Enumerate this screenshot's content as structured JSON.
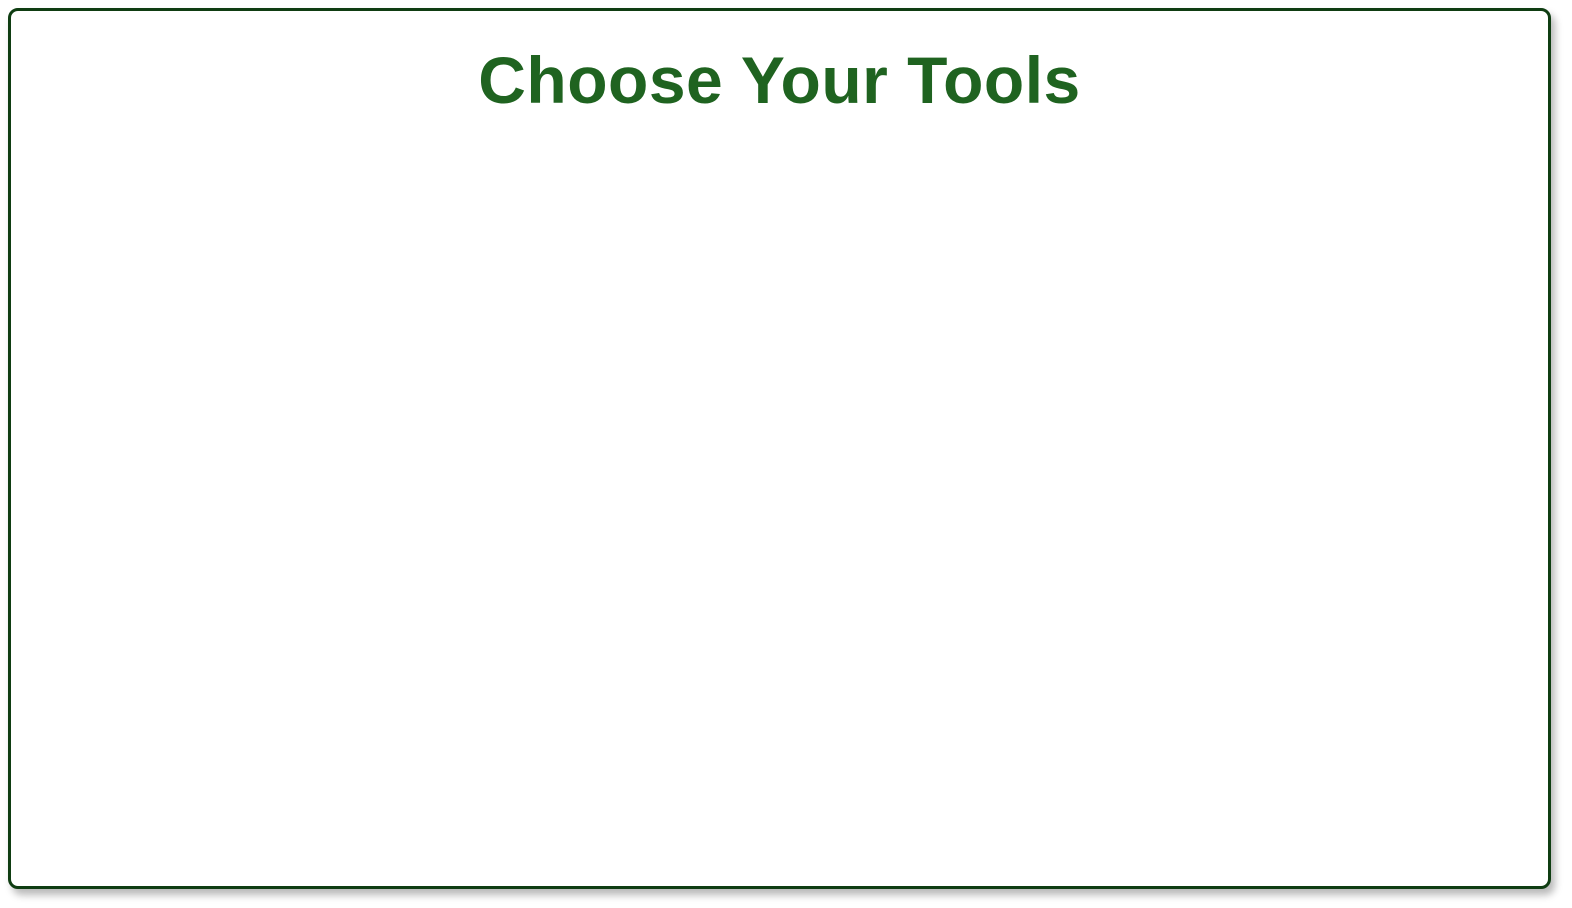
{
  "panel": {
    "title": "Choose Your Tools",
    "border_color": "#0f3d12",
    "title_color": "#1f6320",
    "background_color": "#ffffff"
  }
}
